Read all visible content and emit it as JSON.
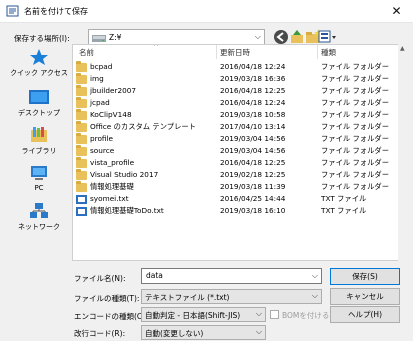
{
  "window": {
    "title": "名前を付けて保存",
    "close_glyph": "✕"
  },
  "location": {
    "label": "保存する場所(I):",
    "value": "Z:¥",
    "arrow": "⌵"
  },
  "places": [
    {
      "label": "クイック アクセス"
    },
    {
      "label": "デスクトップ"
    },
    {
      "label": "ライブラリ"
    },
    {
      "label": "PC"
    },
    {
      "label": "ネットワーク"
    }
  ],
  "columns": {
    "name": "名前",
    "date": "更新日時",
    "type": "種類",
    "sort_caret": "^"
  },
  "files": [
    {
      "name": "bcpad",
      "date": "2016/04/18 12:24",
      "type": "ファイル フォルダー",
      "kind": "folder"
    },
    {
      "name": "img",
      "date": "2019/03/18 16:36",
      "type": "ファイル フォルダー",
      "kind": "folder"
    },
    {
      "name": "jbuilder2007",
      "date": "2016/04/18 12:25",
      "type": "ファイル フォルダー",
      "kind": "folder"
    },
    {
      "name": "jcpad",
      "date": "2016/04/18 12:24",
      "type": "ファイル フォルダー",
      "kind": "folder"
    },
    {
      "name": "KoClipV148",
      "date": "2019/03/18 10:58",
      "type": "ファイル フォルダー",
      "kind": "folder"
    },
    {
      "name": "Office のカスタム テンプレート",
      "date": "2017/04/10 13:14",
      "type": "ファイル フォルダー",
      "kind": "folder"
    },
    {
      "name": "profile",
      "date": "2019/03/04 14:56",
      "type": "ファイル フォルダー",
      "kind": "folder"
    },
    {
      "name": "source",
      "date": "2019/03/04 14:56",
      "type": "ファイル フォルダー",
      "kind": "folder"
    },
    {
      "name": "vista_profile",
      "date": "2016/04/18 12:25",
      "type": "ファイル フォルダー",
      "kind": "folder"
    },
    {
      "name": "Visual Studio 2017",
      "date": "2019/02/18 12:25",
      "type": "ファイル フォルダー",
      "kind": "folder"
    },
    {
      "name": "情報処理基礎",
      "date": "2019/03/18 11:39",
      "type": "ファイル フォルダー",
      "kind": "folder"
    },
    {
      "name": "syomei.txt",
      "date": "2016/04/25 14:44",
      "type": "TXT ファイル",
      "kind": "txt"
    },
    {
      "name": "情報処理基礎ToDo.txt",
      "date": "2019/03/18 16:10",
      "type": "TXT ファイル",
      "kind": "txt"
    }
  ],
  "form": {
    "filename_label": "ファイル名(N):",
    "filename_value": "data",
    "filetype_label": "ファイルの種類(T):",
    "filetype_value": "テキストファイル (*.txt)",
    "encoding_label": "エンコードの種類(C):",
    "encoding_value": "自動判定 - 日本語(Shift-JIS)",
    "bom_label": "BOMを付ける",
    "linebreak_label": "改行コード(R):",
    "linebreak_value": "自動(変更しない)"
  },
  "buttons": {
    "save": "保存(S)",
    "cancel": "キャンセル",
    "help": "ヘルプ(H)"
  }
}
